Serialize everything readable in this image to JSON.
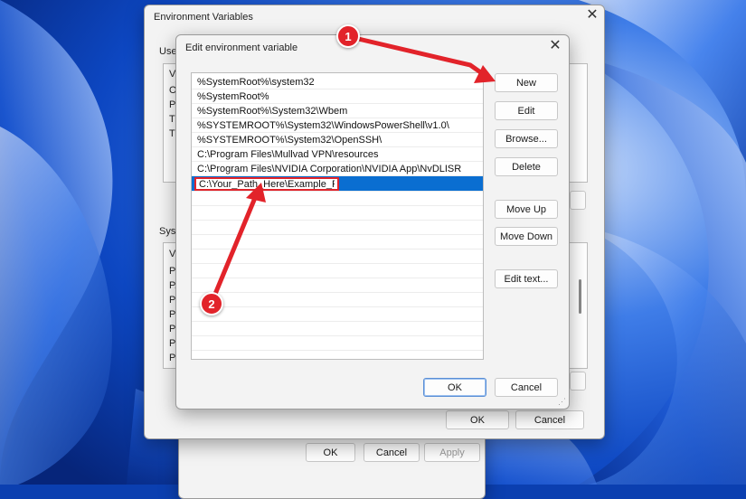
{
  "env_window": {
    "title": "Environment Variables",
    "user_group_label": "User",
    "user_list_items": [
      "Va",
      "Or",
      "Pa",
      "TE",
      "TM"
    ],
    "system_group_label": "Syste",
    "system_list_items": [
      "Va",
      "Pa",
      "PA",
      "PR",
      "PR",
      "PR",
      "PR",
      "PS"
    ],
    "ok_label": "OK",
    "cancel_label": "Cancel"
  },
  "system_props": {
    "ok_label": "OK",
    "cancel_label": "Cancel",
    "apply_label": "Apply"
  },
  "edit_dialog": {
    "title": "Edit environment variable",
    "paths": [
      "%SystemRoot%\\system32",
      "%SystemRoot%",
      "%SystemRoot%\\System32\\Wbem",
      "%SYSTEMROOT%\\System32\\WindowsPowerShell\\v1.0\\",
      "%SYSTEMROOT%\\System32\\OpenSSH\\",
      "C:\\Program Files\\Mullvad VPN\\resources",
      "C:\\Program Files\\NVIDIA Corporation\\NVIDIA App\\NvDLISR"
    ],
    "editing_value": "C:\\Your_Path_Here\\Example_Path",
    "buttons": {
      "new": "New",
      "edit": "Edit",
      "browse": "Browse...",
      "delete": "Delete",
      "move_up": "Move Up",
      "move_down": "Move Down",
      "edit_text": "Edit text..."
    },
    "ok_label": "OK",
    "cancel_label": "Cancel"
  },
  "annotations": {
    "badge1": "1",
    "badge2": "2",
    "color": "#e2232a"
  },
  "colors": {
    "selection": "#0a6ed1",
    "wallpaper": "#0b3fb0"
  }
}
